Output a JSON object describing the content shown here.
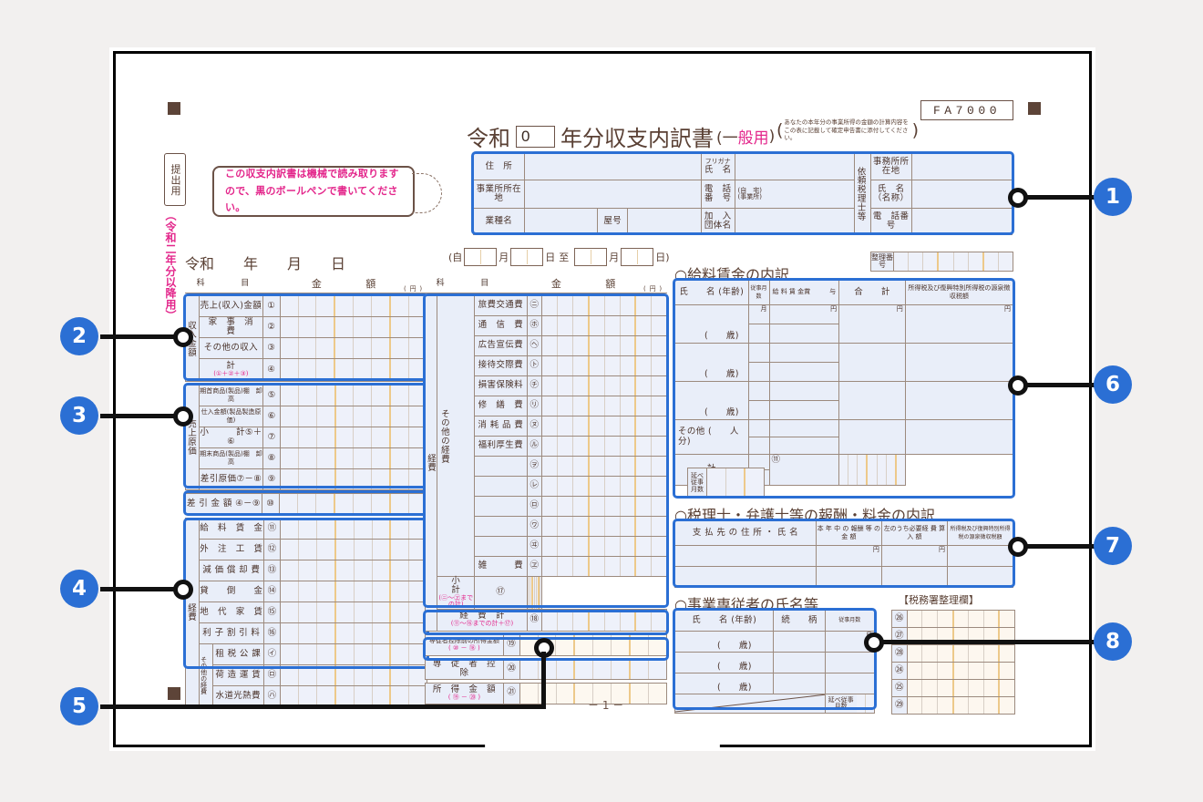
{
  "doc": {
    "form_code": "FA7000",
    "title_prefix": "令和",
    "year_box": "0",
    "title_suffix": "年分収支内訳書",
    "title_kind": "(一般用)",
    "note_paren": "あなたの本年分の事業所得の金額の計算内容をこの表に記載して確定申告書に添付してください。",
    "side_tab": "提出用",
    "side_vertical": "（令和二年分以降用）",
    "instruction": "この収支内訳書は機械で読み取りますので、黒のボールペンで書いてください。",
    "date_line": "令和　　年　　月　　日",
    "period": {
      "open": "(自",
      "m1": "月",
      "d1": "日",
      "to": "至",
      "m2": "月",
      "d2": "日)"
    },
    "seiri_label": "整理番号",
    "page_no": "－ 1 －"
  },
  "header_table": {
    "rows": [
      {
        "l1": "住　所",
        "m1": "フリガナ",
        "m1b": "氏　名",
        "r1": "事務所所在地"
      },
      {
        "l1": "事業所所在地",
        "m1": "電　話",
        "m1b": "番　号",
        "mv1": "(自　宅)",
        "mv2": "(事業所)",
        "r1": "氏　名（名称）"
      },
      {
        "l1": "業種名",
        "l2": "屋号",
        "m1": "加　入",
        "m1b": "団体名",
        "r1": "電　話番　号"
      }
    ],
    "right_side_vertical": "依頼税理士等"
  },
  "left_table": {
    "col_headers": {
      "item": "科　　　目",
      "amount": "金　　　額",
      "unit": "(円)"
    },
    "groups": [
      {
        "side": "収入金額",
        "rows": [
          {
            "name": "売上(収入)金額",
            "no": "①"
          },
          {
            "name": "家　事　消　費",
            "no": "②"
          },
          {
            "name": "その他の収入",
            "no": "③"
          },
          {
            "name": "計",
            "sub": "(①＋②＋③)",
            "no": "④"
          }
        ]
      },
      {
        "side": "売上原価",
        "rows": [
          {
            "name": "期首商品(製品)棚　卸　高",
            "no": "⑤"
          },
          {
            "name": "仕入金額(製品製造原価)",
            "no": "⑥"
          },
          {
            "name": "小　　　計⑤＋⑥",
            "no": "⑦"
          },
          {
            "name": "期末商品(製品)棚　卸　高",
            "no": "⑧"
          },
          {
            "name": "差引原価⑦－⑧",
            "no": "⑨"
          }
        ]
      },
      {
        "side": "",
        "rows": [
          {
            "name": "差 引 金 額 ④－⑨",
            "no": "⑩"
          }
        ]
      },
      {
        "side": "経費",
        "rows": [
          {
            "name": "給　料　賃　金",
            "no": "⑪"
          },
          {
            "name": "外　注　工　賃",
            "no": "⑫"
          },
          {
            "name": "減 価 償 却 費",
            "no": "⑬"
          },
          {
            "name": "貸　　倒　　金",
            "no": "⑭"
          },
          {
            "name": "地　代　家　賃",
            "no": "⑮"
          },
          {
            "name": "利 子 割 引 料",
            "no": "⑯"
          },
          {
            "name": "租 税 公 課",
            "no": "㋑",
            "sub_side": "その他の経費"
          },
          {
            "name": "荷 造 運 賃",
            "no": "㋺"
          },
          {
            "name": "水道光熱費",
            "no": "㋩"
          }
        ]
      }
    ]
  },
  "mid_table": {
    "col_headers": {
      "item": "科　　　目",
      "amount": "金　　　額",
      "unit": "(円)"
    },
    "side_label": "経費",
    "sub_side_label": "その他の経費",
    "rows": [
      {
        "name": "旅費交通費",
        "no": "㋥"
      },
      {
        "name": "通　信　費",
        "no": "㋭"
      },
      {
        "name": "広告宣伝費",
        "no": "㋬"
      },
      {
        "name": "接待交際費",
        "no": "㋣"
      },
      {
        "name": "損害保険料",
        "no": "㋠"
      },
      {
        "name": "修　繕　費",
        "no": "㋷"
      },
      {
        "name": "消 耗 品 費",
        "no": "㋦"
      },
      {
        "name": "福利厚生費",
        "no": "㋸"
      },
      {
        "name": "",
        "no": "㋾"
      },
      {
        "name": "",
        "no": "㋹"
      },
      {
        "name": "",
        "no": "㋺"
      },
      {
        "name": "",
        "no": "㋻"
      },
      {
        "name": "",
        "no": "㋼"
      },
      {
        "name": "雑　　　費",
        "no": "㋽"
      },
      {
        "name": "小　　　計",
        "sub": "(㋥～㋽までの計)",
        "no": "⑰"
      },
      {
        "name": "経　費　計",
        "sub": "(⑪～⑯までの計＋⑰)",
        "no": "⑱"
      }
    ],
    "bottom_rows": [
      {
        "name": "専従者控除前の所得金額",
        "sub": "( ⑩ － ⑱ )",
        "no": "⑲"
      },
      {
        "name": "専　従　者　控　除",
        "no": "⑳"
      },
      {
        "name": "所　得　金　額",
        "sub": "( ⑲ － ⑳ )",
        "no": "㉑"
      }
    ]
  },
  "salary_section": {
    "title": "○給料賃金の内訳",
    "headers": [
      "氏　　名 (年齢)",
      "従事月数",
      "給 料 賃 金賞　　　与",
      "合　　計",
      "所得税及び復興特別所得税の源泉徴収税額"
    ],
    "unit_row": [
      "月",
      "円",
      "円",
      "円"
    ],
    "rows": [
      {
        "name": "",
        "age": "(　　歳)"
      },
      {
        "name": "",
        "age": "(　　歳)"
      },
      {
        "name": "",
        "age": "(　　歳)"
      }
    ],
    "other_row": "その他 (　　人分)",
    "total_label": "計",
    "total_sub": "延べ従事月数",
    "total_no": "⑪"
  },
  "tax_accountant_section": {
    "title": "○税理士・弁護士等の報酬・料金の内訳",
    "headers": [
      "支 払 先 の 住 所 ・ 氏 名",
      "本 年 中 の 報酬 等 の 金 額",
      "左のうち必要経 費 算 入 額",
      "所得税及び復興特別所得税の源泉徴収税額"
    ],
    "unit_row": [
      "円",
      "円"
    ]
  },
  "family_section": {
    "title": "○事業専従者の氏名等",
    "headers": [
      "氏　　名 (年齢)",
      "続　　柄",
      "従事月数"
    ],
    "unit": "月",
    "rows": [
      {
        "age": "(　　歳)"
      },
      {
        "age": "(　　歳)"
      },
      {
        "age": "(　　歳)"
      }
    ],
    "total_label": "延べ従事月数"
  },
  "tax_office_section": {
    "title": "【税務署整理欄】",
    "rows": [
      "㉖",
      "㉗",
      "㉘",
      "㉔",
      "㉕",
      "㉙"
    ]
  },
  "callouts": [
    {
      "id": "1",
      "label": "1"
    },
    {
      "id": "2",
      "label": "2"
    },
    {
      "id": "3",
      "label": "3"
    },
    {
      "id": "4",
      "label": "4"
    },
    {
      "id": "5",
      "label": "5"
    },
    {
      "id": "6",
      "label": "6"
    },
    {
      "id": "7",
      "label": "7"
    },
    {
      "id": "8",
      "label": "8"
    }
  ],
  "colors": {
    "callout_blue": "#2b6fd4",
    "outline_blue": "#2b6fd4",
    "text_brown": "#5a4034",
    "accent_pink": "#e3268b",
    "cell_fill": "#e9eef9",
    "comma_guide": "#edc98a"
  }
}
